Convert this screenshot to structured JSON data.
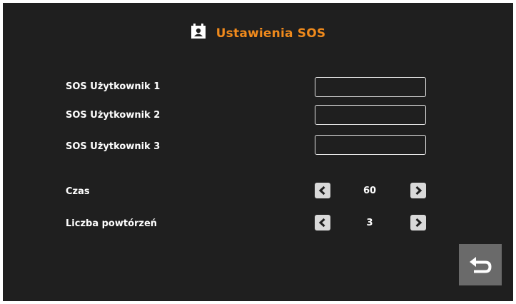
{
  "header": {
    "title": "Ustawienia SOS",
    "icon": "contact-card-icon",
    "title_color": "#f08a1c"
  },
  "users": [
    {
      "label": "SOS Użytkownik  1",
      "value": ""
    },
    {
      "label": "SOS Użytkownik 2",
      "value": ""
    },
    {
      "label": "SOS Użytkownik 3",
      "value": ""
    }
  ],
  "settings": {
    "time": {
      "label": "Czas",
      "value": "60"
    },
    "repeat": {
      "label": "Liczba powtórzeń",
      "value": "3"
    }
  },
  "icons": {
    "prev": "chevron-left-icon",
    "next": "chevron-right-icon",
    "back": "return-arrow-icon"
  },
  "colors": {
    "background": "#1f1f1f",
    "accent": "#f08a1c",
    "button": "#d9d9d9",
    "back_button": "#6a6a6a"
  }
}
